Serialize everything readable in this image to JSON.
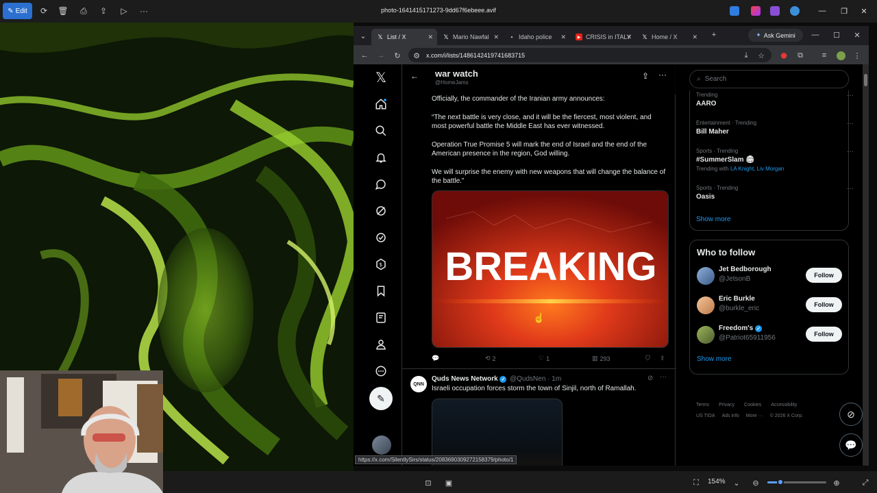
{
  "viewer": {
    "edit_label": "Edit",
    "file_title": "photo-1641415171273-9dd67f6ebeee.avif",
    "zoom_value": "154%",
    "icons": [
      "rotate-icon",
      "delete-icon",
      "print-icon",
      "share-icon",
      "slideshow-icon",
      "more-icon"
    ]
  },
  "browser": {
    "tabs": [
      {
        "label": "List / X",
        "active": true
      },
      {
        "label": "Mario Nawfal",
        "active": false
      },
      {
        "label": "Idaho police",
        "active": false
      },
      {
        "label": "CRISIS in ITALY",
        "active": false
      },
      {
        "label": "Home / X",
        "active": false
      }
    ],
    "gemini_label": "Ask Gemini",
    "url": "x.com/i/lists/1486142419741683715",
    "status_url": "https://x.com/SilentlySirs/status/2083690309272158379/photo/1"
  },
  "x": {
    "list_title": "war watch",
    "list_handle": "@HomeJams",
    "tweet": {
      "paragraphs": [
        "Officially, the commander of the Iranian army announces:",
        "“The next battle is very close, and it will be the fiercest, most violent, and most powerful battle the Middle East has ever witnessed.",
        "Operation True Promise 5 will mark the end of Israel and the end of the American presence in the region, God willing.",
        "We will surprise the enemy with new weapons that will change the balance of the battle.”"
      ],
      "media_text": "BREAKING",
      "replies": "",
      "reposts": "2",
      "likes": "1",
      "views": "293"
    },
    "tweet2": {
      "avatar_text": "QNN",
      "name": "Quds News Network",
      "meta": "@QudsNen · 1m",
      "text": "Israeli occupation forces storm the town of Sinjil, north of Ramallah."
    },
    "search_placeholder": "Search",
    "trends": [
      {
        "category": "Trending",
        "name": "AARO"
      },
      {
        "category": "Entertainment · Trending",
        "name": "Bill Maher"
      },
      {
        "category": "Sports · Trending",
        "name": "#SummerSlam 🏟"
      },
      {
        "category": "Sports · Trending",
        "name": "Oasis"
      }
    ],
    "trending_with_prefix": "Trending with",
    "trending_with_names": "LA Knight, Liv Morgan",
    "show_more": "Show more",
    "who_to_follow": {
      "title": "Who to follow",
      "people": [
        {
          "name": "Jet Bedborough",
          "handle": "@JetsonB",
          "verified": false
        },
        {
          "name": "Eric Burkle",
          "handle": "@burkle_eric",
          "verified": false
        },
        {
          "name": "Freedom's",
          "handle": "@Patriot65911956",
          "verified": true
        }
      ],
      "follow_label": "Follow",
      "show_more": "Show more"
    },
    "footer": {
      "row1": [
        "Terms",
        "Privacy",
        "Cookies",
        "Accessibility"
      ],
      "row2": [
        "US TIDA",
        "Ads info",
        "More ···",
        "© 2026 X Corp."
      ]
    }
  },
  "colors": {
    "accent": "#1d9bf0",
    "breaking_red": "#e03a1a",
    "edit_blue": "#2b6fd0"
  }
}
